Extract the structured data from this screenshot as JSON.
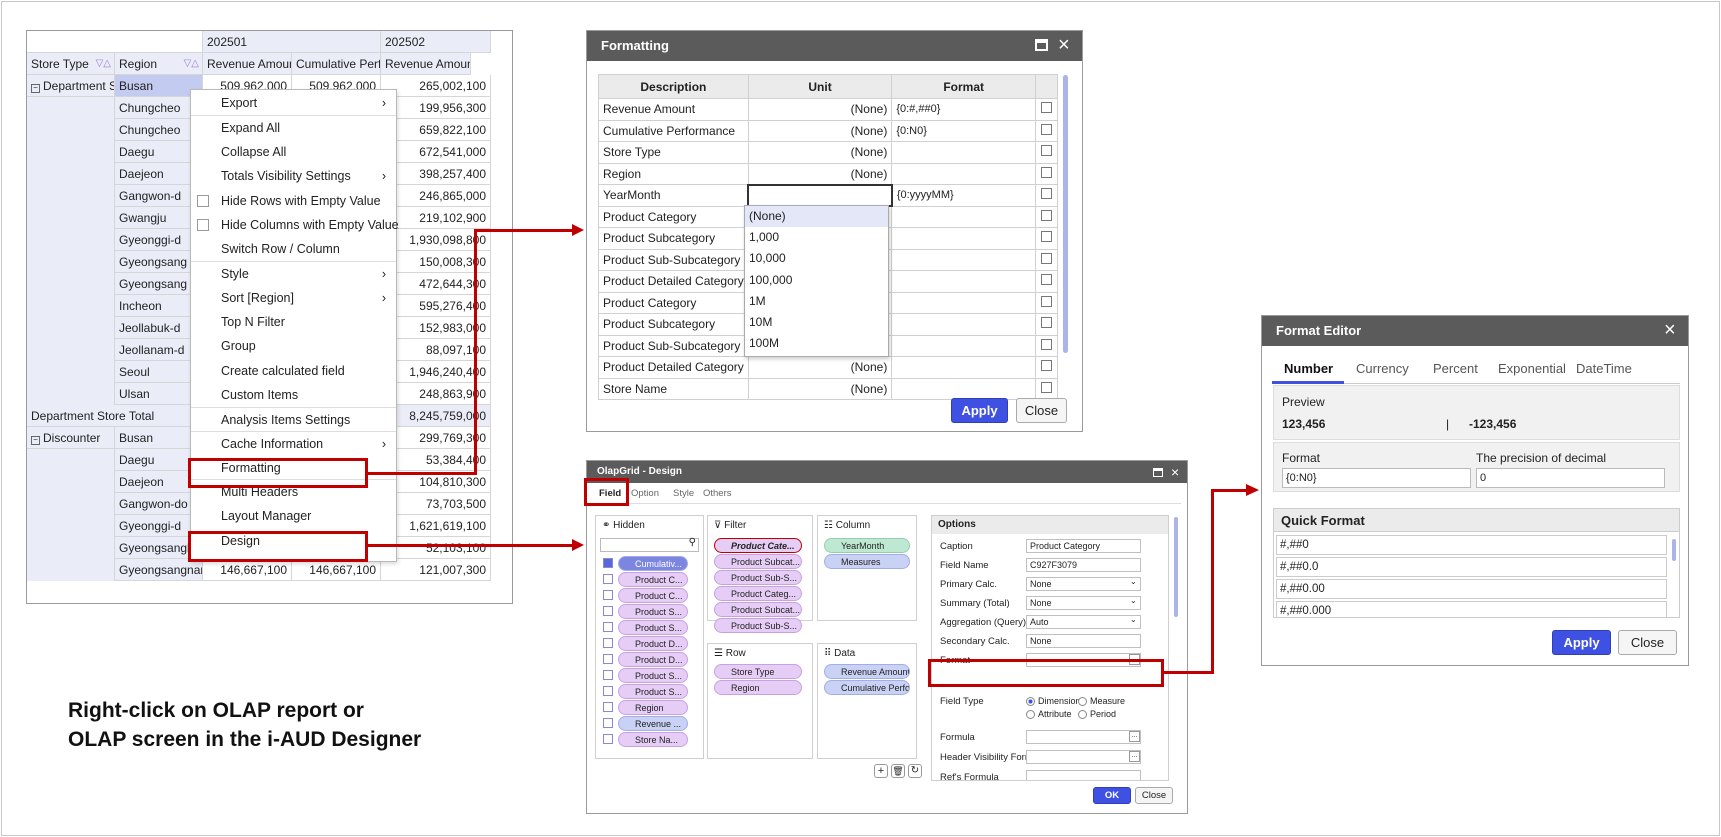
{
  "pivot": {
    "header_top": [
      "",
      "",
      "202501",
      "202502"
    ],
    "header_cols": [
      "Store Type",
      "Region",
      "Revenue Amount",
      "Cumulative Perfo",
      "Revenue Amoun"
    ],
    "rows": [
      {
        "store": "Department St",
        "region": "Busan",
        "c1": "509,962,000",
        "c2": "509,962,000",
        "c3": "265,002,100"
      },
      {
        "store": "",
        "region": "Chungcheo",
        "c1": "",
        "c2": "300",
        "c3": "199,956,300"
      },
      {
        "store": "",
        "region": "Chungcheo",
        "c1": "",
        "c2": "900",
        "c3": "659,822,100"
      },
      {
        "store": "",
        "region": "Daegu",
        "c1": "",
        "c2": "900",
        "c3": "672,541,000"
      },
      {
        "store": "",
        "region": "Daejeon",
        "c1": "",
        "c2": "900",
        "c3": "398,257,400"
      },
      {
        "store": "",
        "region": "Gangwon-d",
        "c1": "",
        "c2": "400",
        "c3": "246,865,000"
      },
      {
        "store": "",
        "region": "Gwangju",
        "c1": "",
        "c2": "900",
        "c3": "219,102,900"
      },
      {
        "store": "",
        "region": "Gyeonggi-d",
        "c1": "",
        "c2": "100",
        "c3": "1,930,098,800"
      },
      {
        "store": "",
        "region": "Gyeongsang",
        "c1": "",
        "c2": "300",
        "c3": "150,008,300"
      },
      {
        "store": "",
        "region": "Gyeongsang",
        "c1": "",
        "c2": "600",
        "c3": "472,644,300"
      },
      {
        "store": "",
        "region": "Incheon",
        "c1": "",
        "c2": "200",
        "c3": "595,276,400"
      },
      {
        "store": "",
        "region": "Jeollabuk-d",
        "c1": "",
        "c2": "700",
        "c3": "152,983,000"
      },
      {
        "store": "",
        "region": "Jeollanam-d",
        "c1": "",
        "c2": "400",
        "c3": "88,097,100"
      },
      {
        "store": "",
        "region": "Seoul",
        "c1": "",
        "c2": "900",
        "c3": "1,946,240,400"
      },
      {
        "store": "",
        "region": "Ulsan",
        "c1": "",
        "c2": "100",
        "c3": "248,863,900"
      },
      {
        "store": "Department Store Total",
        "region": "",
        "c1": "",
        "c2": "600",
        "c3": "8,245,759,000"
      },
      {
        "store": "Discounter",
        "region": "Busan",
        "c1": "",
        "c2": "600",
        "c3": "299,769,300"
      },
      {
        "store": "",
        "region": "Daegu",
        "c1": "",
        "c2": "300",
        "c3": "53,384,400"
      },
      {
        "store": "",
        "region": "Daejeon",
        "c1": "",
        "c2": "800",
        "c3": "104,810,300"
      },
      {
        "store": "",
        "region": "Gangwon-do",
        "c1": "",
        "c2": "600",
        "c3": "73,703,500"
      },
      {
        "store": "",
        "region": "Gyeonggi-d",
        "c1": "",
        "c2": "600",
        "c3": "1,621,619,100"
      },
      {
        "store": "",
        "region": "Gyeongsangbuk",
        "c1": "",
        "c2": "",
        "c3": "52,103,100"
      },
      {
        "store": "",
        "region": "Gyeongsangnam",
        "c1": "146,667,100",
        "c2": "146,667,100",
        "c3": "121,007,300"
      }
    ]
  },
  "context_menu": [
    {
      "label": "Export",
      "sub": true
    },
    {
      "label": "Expand All"
    },
    {
      "label": "Collapse All"
    },
    {
      "label": "Totals Visibility Settings",
      "sub": true
    },
    {
      "label": "Hide Rows with Empty Value",
      "check": true
    },
    {
      "label": "Hide Columns with Empty Value",
      "check": true
    },
    {
      "label": "Switch Row / Column"
    },
    {
      "label": "Style",
      "sub": true
    },
    {
      "label": "Sort [Region]",
      "sub": true
    },
    {
      "label": "Top N Filter"
    },
    {
      "label": "Group"
    },
    {
      "label": "Create calculated field"
    },
    {
      "label": "Custom Items"
    },
    {
      "label": "Analysis Items Settings"
    },
    {
      "label": "Cache Information",
      "sub": true
    },
    {
      "label": "Formatting"
    },
    {
      "label": "Multi Headers"
    },
    {
      "label": "Layout Manager"
    },
    {
      "label": "Design"
    }
  ],
  "formatting": {
    "title": "Formatting",
    "columns": [
      "Description",
      "Unit",
      "Format"
    ],
    "rows": [
      {
        "d": "Revenue Amount",
        "u": "(None)",
        "f": "{0:#,##0}"
      },
      {
        "d": "Cumulative Performance",
        "u": "(None)",
        "f": "{0:N0}"
      },
      {
        "d": "Store Type",
        "u": "(None)",
        "f": ""
      },
      {
        "d": "Region",
        "u": "(None)",
        "f": ""
      },
      {
        "d": "YearMonth",
        "u": "",
        "f": "{0:yyyyMM}"
      },
      {
        "d": "Product Category",
        "u": "",
        "f": ""
      },
      {
        "d": "Product Subcategory",
        "u": "",
        "f": ""
      },
      {
        "d": "Product Sub-Subcategory",
        "u": "",
        "f": ""
      },
      {
        "d": "Product Detailed Category",
        "u": "",
        "f": ""
      },
      {
        "d": "Product Category",
        "u": "",
        "f": ""
      },
      {
        "d": "Product Subcategory",
        "u": "",
        "f": ""
      },
      {
        "d": "Product Sub-Subcategory",
        "u": "",
        "f": ""
      },
      {
        "d": "Product Detailed Category",
        "u": "(None)",
        "f": ""
      },
      {
        "d": "Store Name",
        "u": "(None)",
        "f": ""
      }
    ],
    "unit_options": [
      "(None)",
      "1,000",
      "10,000",
      "100,000",
      "1M",
      "10M",
      "100M"
    ],
    "apply": "Apply",
    "close": "Close"
  },
  "design": {
    "title": "OlapGrid - Design",
    "tabs": [
      "Field",
      "Option",
      "Style",
      "Others"
    ],
    "hidden_title": "Hidden",
    "hidden_items": [
      "Cumulativ...",
      "Product C...",
      "Product C...",
      "Product S...",
      "Product S...",
      "Product D...",
      "Product D...",
      "Product S...",
      "Product S...",
      "Region",
      "Revenue ...",
      "Store Na..."
    ],
    "filter_title": "Filter",
    "filter_items": [
      "Product Cate...",
      "Product Subcat...",
      "Product Sub-S...",
      "Product Categ...",
      "Product Subcat...",
      "Product Sub-S..."
    ],
    "column_title": "Column",
    "column_items": [
      "YearMonth",
      "Measures"
    ],
    "row_title": "Row",
    "row_items": [
      "Store Type",
      "Region"
    ],
    "data_title": "Data",
    "data_items": [
      "Revenue Amount",
      "Cumulative Perfor..."
    ],
    "options_title": "Options",
    "options": [
      {
        "label": "Caption",
        "value": "Product Category"
      },
      {
        "label": "Field Name",
        "value": "C927F3079"
      },
      {
        "label": "Primary Calc.",
        "value": "None"
      },
      {
        "label": "Summary (Total)",
        "value": "None"
      },
      {
        "label": "Aggregation (Query)",
        "value": "Auto"
      },
      {
        "label": "Secondary Calc.",
        "value": "None"
      },
      {
        "label": "Format",
        "value": ""
      }
    ],
    "field_type_label": "Field Type",
    "field_types": [
      "Dimension",
      "Measure",
      "Attribute",
      "Period"
    ],
    "formula_label": "Formula",
    "header_vis_label": "Header Visibility Formula",
    "ref_formula_label": "Ref's Formula",
    "ok": "OK",
    "close": "Close"
  },
  "format_editor": {
    "title": "Format Editor",
    "tabs": [
      "Number",
      "Currency",
      "Percent",
      "Exponential",
      "DateTime"
    ],
    "preview_label": "Preview",
    "preview_pos": "123,456",
    "preview_sep": "|",
    "preview_neg": "-123,456",
    "format_label": "Format",
    "format_value": "{0:N0}",
    "precision_label": "The precision of decimal",
    "precision_value": "0",
    "quick_label": "Quick Format",
    "quick_items": [
      "#,##0",
      "#,##0.0",
      "#,##0.00",
      "#,##0.000"
    ],
    "apply": "Apply",
    "close": "Close"
  },
  "caption": {
    "line1": "Right-click on OLAP report or",
    "line2": "OLAP screen in the i-AUD Designer"
  },
  "colors": {
    "accent": "#3f51e3",
    "highlight": "#c00000",
    "header": "#eaedf8",
    "titlebar": "#5b5b5b"
  }
}
